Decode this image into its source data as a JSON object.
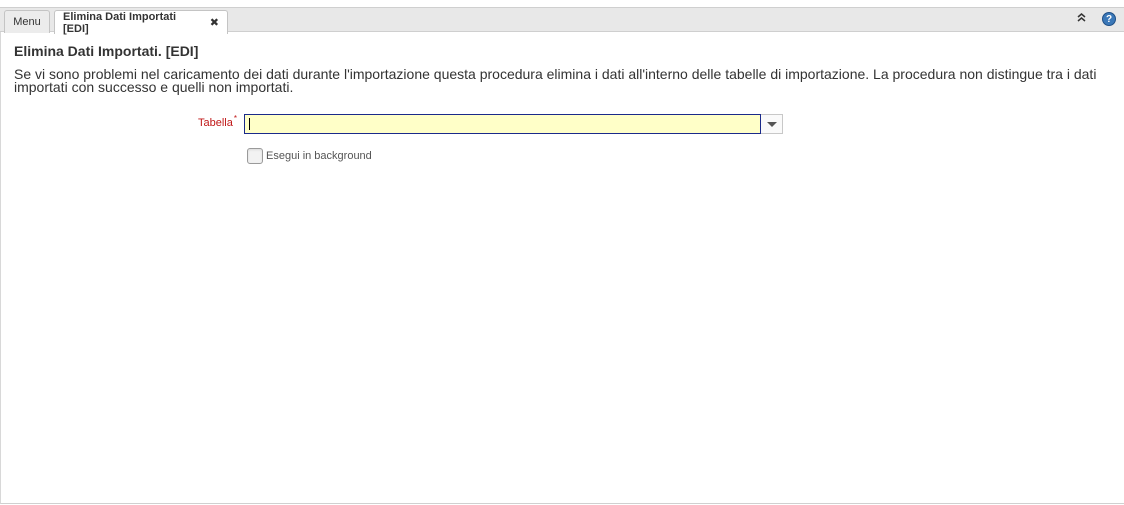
{
  "tabs": {
    "menu_label": "Menu",
    "active_label": "Elimina Dati Importati [EDI]",
    "close_glyph": "✖"
  },
  "toolbar": {
    "collapse_glyph": "⌃",
    "help_glyph": "?"
  },
  "page": {
    "title": "Elimina Dati Importati. [EDI]",
    "description": "Se vi sono problemi nel caricamento dei dati durante l'importazione questa procedura elimina i dati all'interno delle tabelle di importazione. La procedura non distingue tra i dati importati con successo e quelli non importati."
  },
  "form": {
    "tabella_label": "Tabella",
    "required_marker": "*",
    "tabella_value": "",
    "background_label": "Esegui in background",
    "background_checked": false
  },
  "colors": {
    "required_label": "#c01818",
    "input_bg": "#ffffc8",
    "input_border": "#1a2a8a",
    "help_icon": "#3b78b8"
  }
}
